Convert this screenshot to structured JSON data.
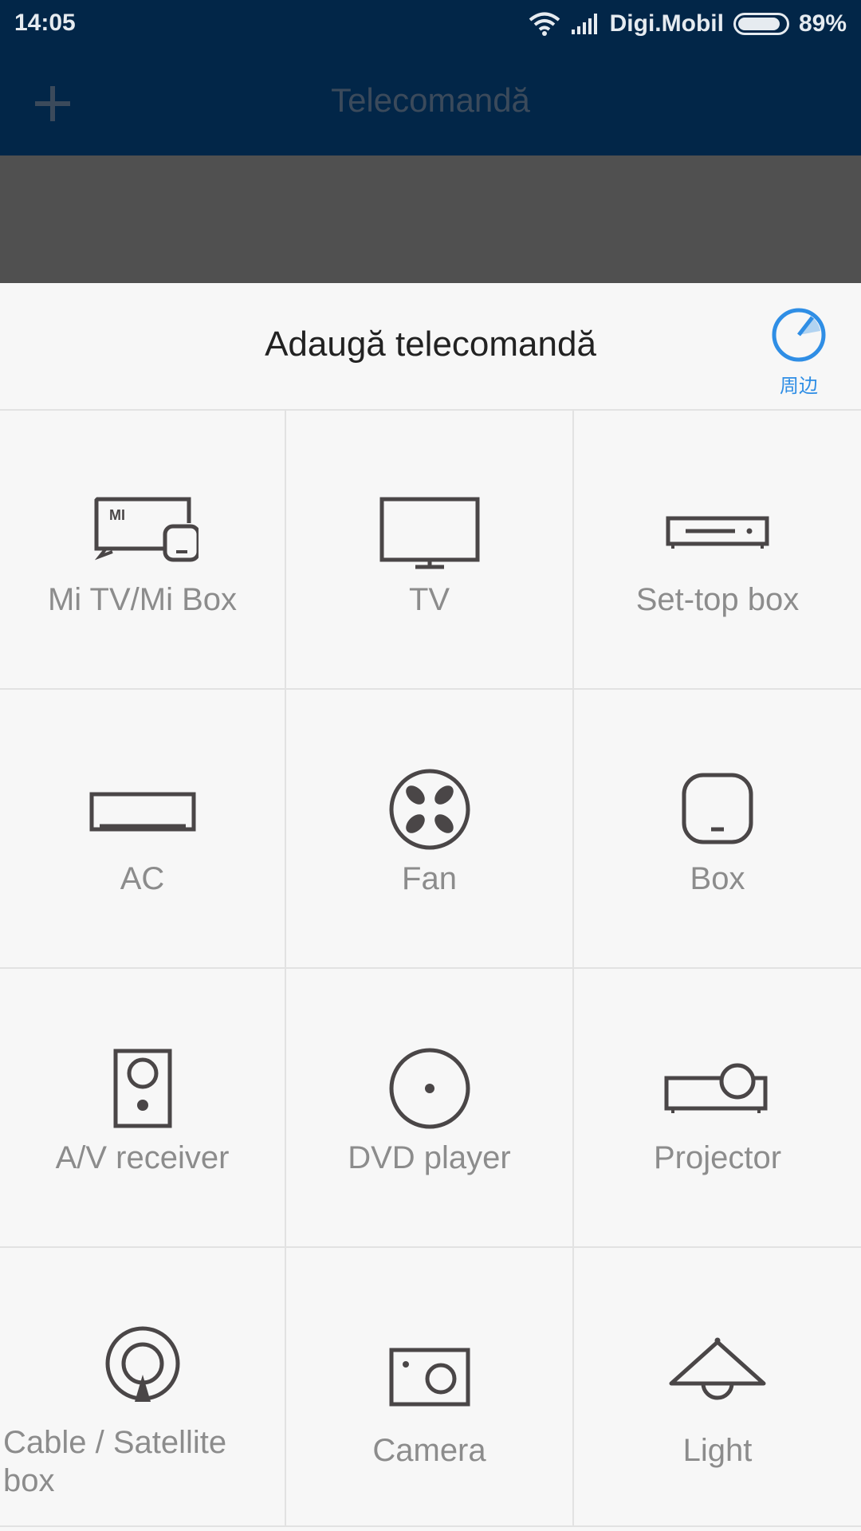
{
  "status_bar": {
    "time": "14:05",
    "carrier": "Digi.Mobil",
    "battery_percent": "89%",
    "battery_level": 0.89,
    "icons": [
      "wifi-icon",
      "signal-icon",
      "battery-icon"
    ]
  },
  "app_bar": {
    "title": "Telecomandă",
    "add_icon": "plus-icon"
  },
  "sheet": {
    "title": "Adaugă telecomandă",
    "nearby_label": "周边",
    "nearby_icon": "radar-icon",
    "accent_color": "#2f8ee5"
  },
  "devices": [
    {
      "label": "Mi TV/Mi Box",
      "icon": "mi-tv-box-icon"
    },
    {
      "label": "TV",
      "icon": "tv-icon"
    },
    {
      "label": "Set-top box",
      "icon": "set-top-box-icon"
    },
    {
      "label": "AC",
      "icon": "ac-icon"
    },
    {
      "label": "Fan",
      "icon": "fan-icon"
    },
    {
      "label": "Box",
      "icon": "box-icon"
    },
    {
      "label": "A/V receiver",
      "icon": "speaker-icon"
    },
    {
      "label": "DVD player",
      "icon": "dvd-icon"
    },
    {
      "label": "Projector",
      "icon": "projector-icon"
    },
    {
      "label": "Cable / Satellite box",
      "icon": "satellite-icon"
    },
    {
      "label": "Camera",
      "icon": "camera-icon"
    },
    {
      "label": "Light",
      "icon": "lamp-icon"
    }
  ]
}
